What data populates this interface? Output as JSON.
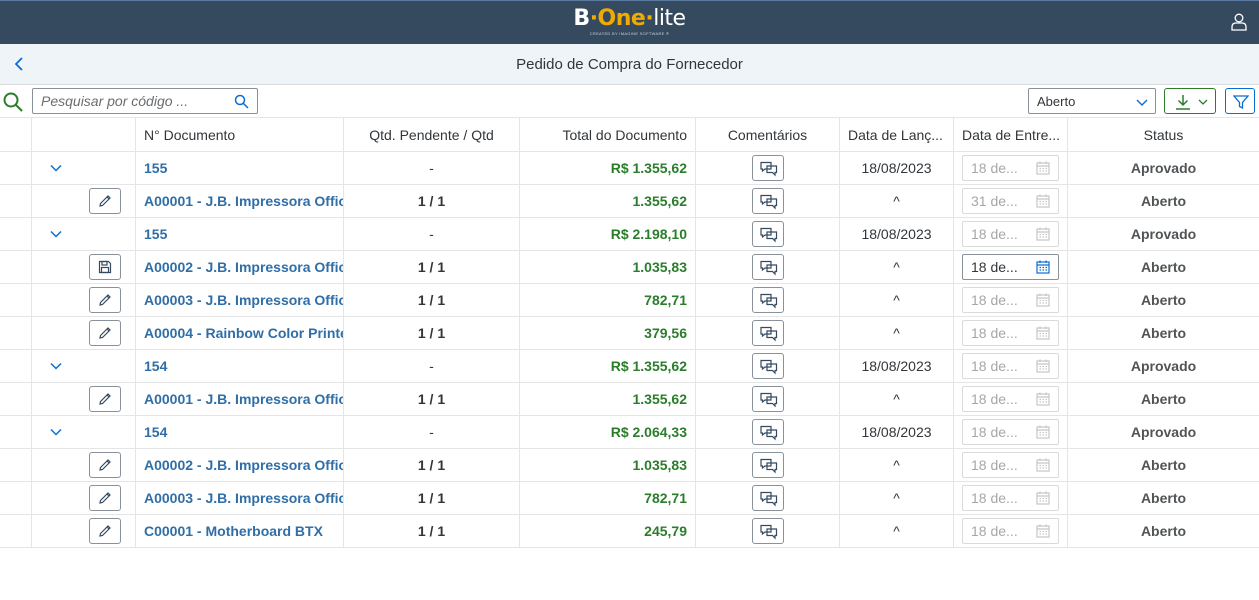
{
  "app": {
    "logo_b": "B",
    "logo_one": "One",
    "logo_lite": "lite",
    "logo_sub": "CREATED BY IMAGINE SOFTWARE ®"
  },
  "page": {
    "title": "Pedido de Compra do Fornecedor"
  },
  "toolbar": {
    "search_placeholder": "Pesquisar por código ...",
    "status_value": "Aberto"
  },
  "columns": [
    "N° Documento",
    "Qtd. Pendente / Qtd",
    "Total do Documento",
    "Comentários",
    "Data de Lanç...",
    "Data de Entre...",
    "Status"
  ],
  "rows": [
    {
      "type": "group",
      "doc": "155",
      "qty": "-",
      "total": "R$ 1.355,62",
      "date": "18/08/2023",
      "delivery": "18 de...",
      "status": "Aprovado"
    },
    {
      "type": "item",
      "action": "edit",
      "doc": "A00001 - J.B. Impressora Offic",
      "qty": "1 / 1",
      "total": "1.355,62",
      "date": "^",
      "delivery": "31 de...",
      "status": "Aberto"
    },
    {
      "type": "group",
      "doc": "155",
      "qty": "-",
      "total": "R$ 2.198,10",
      "date": "18/08/2023",
      "delivery": "18 de...",
      "status": "Aprovado"
    },
    {
      "type": "item",
      "action": "save",
      "doc": "A00002 - J.B. Impressora Offic",
      "qty": "1 / 1",
      "total": "1.035,83",
      "date": "^",
      "delivery": "18 de...",
      "status": "Aberto",
      "active": true
    },
    {
      "type": "item",
      "action": "edit",
      "doc": "A00003 - J.B. Impressora Offic",
      "qty": "1 / 1",
      "total": "782,71",
      "date": "^",
      "delivery": "18 de...",
      "status": "Aberto"
    },
    {
      "type": "item",
      "action": "edit",
      "doc": "A00004 - Rainbow Color Printe",
      "qty": "1 / 1",
      "total": "379,56",
      "date": "^",
      "delivery": "18 de...",
      "status": "Aberto"
    },
    {
      "type": "group",
      "doc": "154",
      "qty": "-",
      "total": "R$ 1.355,62",
      "date": "18/08/2023",
      "delivery": "18 de...",
      "status": "Aprovado"
    },
    {
      "type": "item",
      "action": "edit",
      "doc": "A00001 - J.B. Impressora Offic",
      "qty": "1 / 1",
      "total": "1.355,62",
      "date": "^",
      "delivery": "18 de...",
      "status": "Aberto"
    },
    {
      "type": "group",
      "doc": "154",
      "qty": "-",
      "total": "R$ 2.064,33",
      "date": "18/08/2023",
      "delivery": "18 de...",
      "status": "Aprovado"
    },
    {
      "type": "item",
      "action": "edit",
      "doc": "A00002 - J.B. Impressora Offic",
      "qty": "1 / 1",
      "total": "1.035,83",
      "date": "^",
      "delivery": "18 de...",
      "status": "Aberto"
    },
    {
      "type": "item",
      "action": "edit",
      "doc": "A00003 - J.B. Impressora Offic",
      "qty": "1 / 1",
      "total": "782,71",
      "date": "^",
      "delivery": "18 de...",
      "status": "Aberto"
    },
    {
      "type": "item",
      "action": "edit",
      "doc": "C00001 - Motherboard BTX",
      "qty": "1 / 1",
      "total": "245,79",
      "date": "^",
      "delivery": "18 de...",
      "status": "Aberto"
    }
  ],
  "icons": {
    "user": "user-icon",
    "back": "chevron-left-icon",
    "search": "search-icon",
    "expand": "chevron-down-icon",
    "edit": "pencil-icon",
    "save": "save-icon",
    "comment": "comment-icon",
    "calendar": "calendar-icon",
    "download": "download-icon",
    "filter": "filter-icon"
  },
  "colors": {
    "shell": "#354a5f",
    "accent": "#f0ab00",
    "link": "#2f6ea7",
    "positive": "#2b7d2b",
    "subheader": "#eff4f9"
  }
}
